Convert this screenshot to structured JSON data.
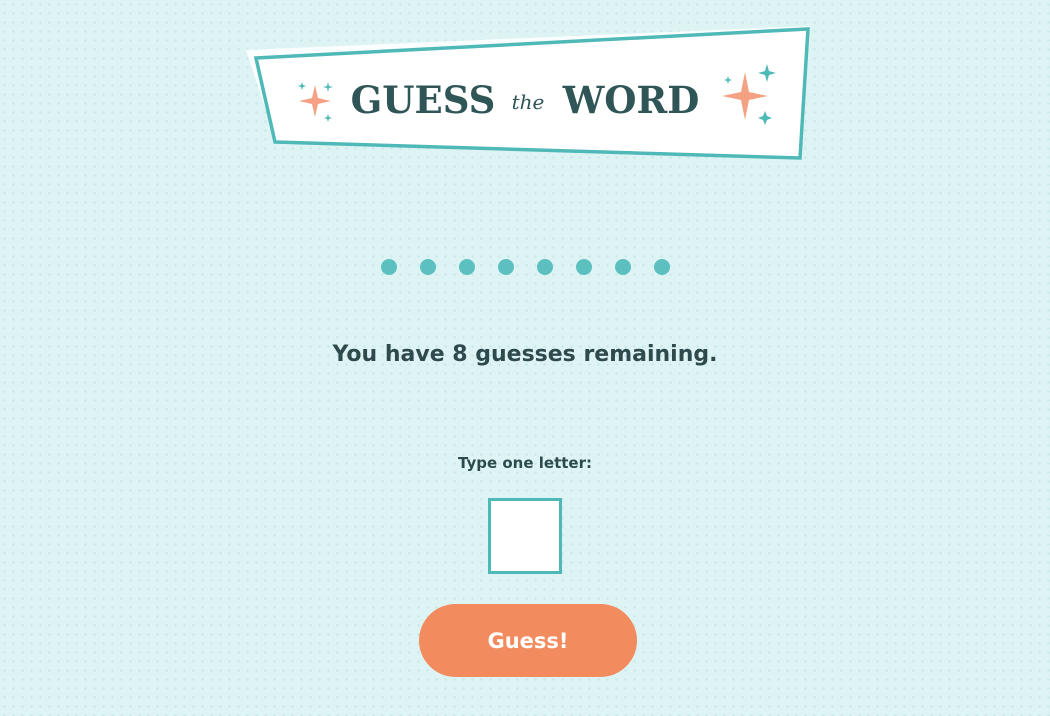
{
  "header": {
    "title_part1": "GUESS",
    "title_part2": "the",
    "title_part3": "WORD"
  },
  "word": {
    "letter_count": 8,
    "placeholder_symbol": "●"
  },
  "status": {
    "remaining_text": "You have 8 guesses remaining."
  },
  "input": {
    "label": "Type one letter:",
    "value": ""
  },
  "button": {
    "label": "Guess!"
  },
  "colors": {
    "background": "#def4f4",
    "teal": "#5cc0c0",
    "teal_border": "#4fb9b8",
    "dark_text": "#2f4a4c",
    "coral": "#f28b5d",
    "white": "#ffffff"
  },
  "icons": [
    "sparkle-icon"
  ]
}
